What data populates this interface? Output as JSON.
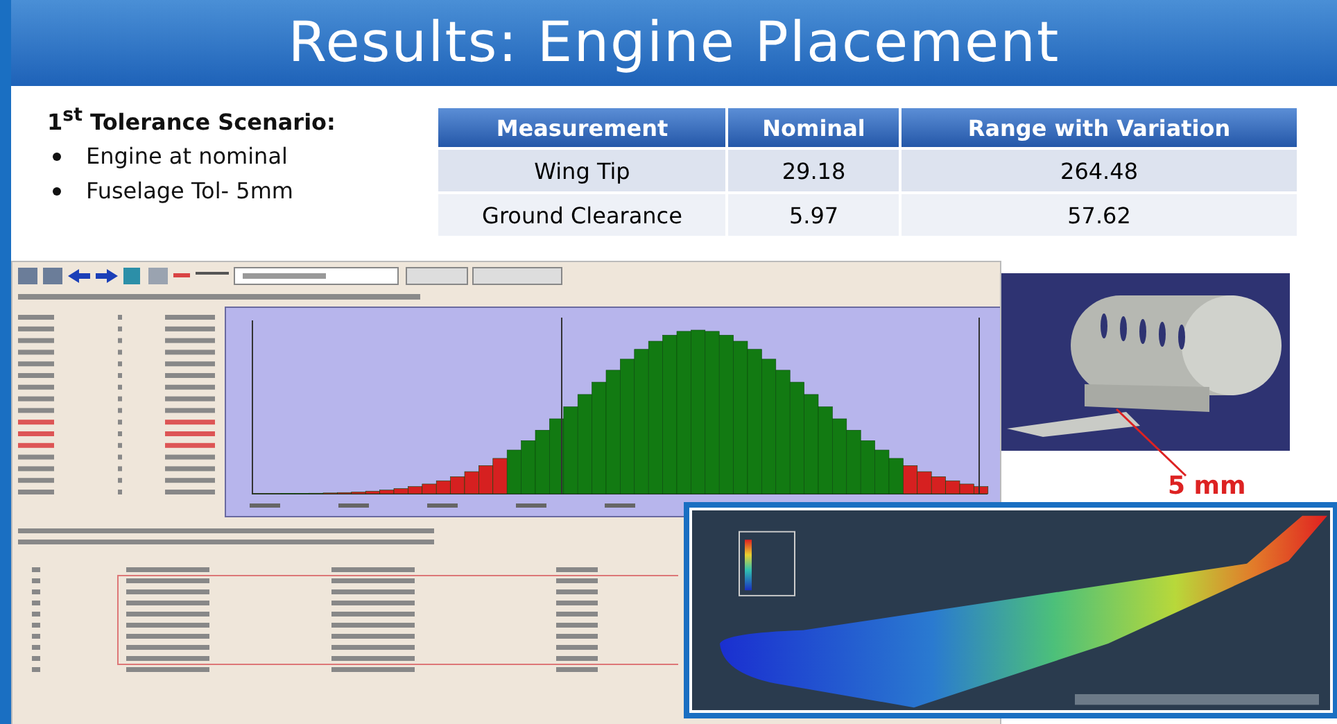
{
  "title": "Results: Engine Placement",
  "scenario": {
    "heading": "1$^{st}$ Tolerance Scenario:",
    "bullets": [
      "Engine at nominal",
      "Fuselage Tol- 5mm"
    ]
  },
  "table": {
    "columns": [
      "Measurement",
      "Nominal",
      "Range with Variation"
    ],
    "rows": [
      [
        "Wing Tip",
        "29.18",
        "264.48"
      ],
      [
        "Ground Clearance",
        "5.97",
        "57.62"
      ]
    ]
  },
  "engine_callout": {
    "label": "5 mm"
  }
}
